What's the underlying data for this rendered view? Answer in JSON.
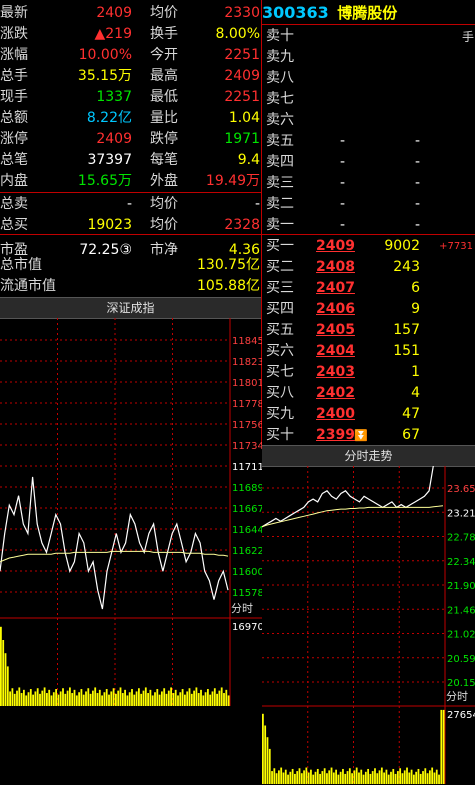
{
  "quote": {
    "rows": [
      {
        "l1": "最新",
        "v1": "2409",
        "c1": "red",
        "l2": "均价",
        "v2": "2330",
        "c2": "red"
      },
      {
        "l1": "涨跌",
        "v1": "▲219",
        "c1": "red",
        "l2": "换手",
        "v2": "8.00%",
        "c2": "yel"
      },
      {
        "l1": "涨幅",
        "v1": "10.00%",
        "c1": "red",
        "l2": "今开",
        "v2": "2251",
        "c2": "red"
      },
      {
        "l1": "总手",
        "v1": "35.15万",
        "c1": "yel",
        "l2": "最高",
        "v2": "2409",
        "c2": "red"
      },
      {
        "l1": "现手",
        "v1": "1337",
        "c1": "grn",
        "l2": "最低",
        "v2": "2251",
        "c2": "red"
      },
      {
        "l1": "总额",
        "v1": "8.22亿",
        "c1": "cyn",
        "l2": "量比",
        "v2": "1.04",
        "c2": "yel"
      },
      {
        "l1": "涨停",
        "v1": "2409",
        "c1": "red",
        "l2": "跌停",
        "v2": "1971",
        "c2": "grn"
      },
      {
        "l1": "总笔",
        "v1": "37397",
        "c1": "wht",
        "l2": "每笔",
        "v2": "9.4",
        "c2": "yel"
      },
      {
        "l1": "内盘",
        "v1": "15.65万",
        "c1": "grn",
        "l2": "外盘",
        "v2": "19.49万",
        "c2": "red"
      },
      {
        "l1": "总卖",
        "v1": "-",
        "c1": "wht",
        "l2": "均价",
        "v2": "-",
        "c2": "wht"
      },
      {
        "l1": "总买",
        "v1": "19023",
        "c1": "yel",
        "l2": "均价",
        "v2": "2328",
        "c2": "red"
      },
      {
        "l1": "市盈",
        "v1": "72.25③",
        "c1": "wht",
        "l2": "市净",
        "v2": "4.36",
        "c2": "yel"
      }
    ],
    "market_cap_label": "总市值",
    "market_cap": "130.75亿",
    "float_cap_label": "流通市值",
    "float_cap": "105.88亿"
  },
  "stock": {
    "code": "300363",
    "name": "博腾股份",
    "unit": "手"
  },
  "order_book": {
    "asks": [
      {
        "label": "卖十",
        "price": "",
        "vol": ""
      },
      {
        "label": "卖九",
        "price": "",
        "vol": ""
      },
      {
        "label": "卖八",
        "price": "",
        "vol": ""
      },
      {
        "label": "卖七",
        "price": "",
        "vol": ""
      },
      {
        "label": "卖六",
        "price": "",
        "vol": ""
      },
      {
        "label": "卖五",
        "price": "-",
        "vol": "-"
      },
      {
        "label": "卖四",
        "price": "-",
        "vol": "-"
      },
      {
        "label": "卖三",
        "price": "-",
        "vol": "-"
      },
      {
        "label": "卖二",
        "price": "-",
        "vol": "-"
      },
      {
        "label": "卖一",
        "price": "-",
        "vol": "-"
      }
    ],
    "bids": [
      {
        "label": "买一",
        "price": "2409",
        "vol": "9002",
        "chg": "+7731"
      },
      {
        "label": "买二",
        "price": "2408",
        "vol": "243",
        "chg": ""
      },
      {
        "label": "买三",
        "price": "2407",
        "vol": "6",
        "chg": ""
      },
      {
        "label": "买四",
        "price": "2406",
        "vol": "9",
        "chg": ""
      },
      {
        "label": "买五",
        "price": "2405",
        "vol": "157",
        "chg": ""
      },
      {
        "label": "买六",
        "price": "2404",
        "vol": "151",
        "chg": ""
      },
      {
        "label": "买七",
        "price": "2403",
        "vol": "1",
        "chg": ""
      },
      {
        "label": "买八",
        "price": "2402",
        "vol": "4",
        "chg": ""
      },
      {
        "label": "买九",
        "price": "2400",
        "vol": "47",
        "chg": ""
      },
      {
        "label": "买十",
        "price": "2399",
        "vol": "67",
        "chg": ""
      }
    ]
  },
  "index_panel": {
    "title": "深证成指",
    "ticks": [
      "11845",
      "11823",
      "11801",
      "11778",
      "11756",
      "11734",
      "11711",
      "11689",
      "11667",
      "11644",
      "11622",
      "11600",
      "11578"
    ],
    "vol_max": "16970",
    "time_label": "分时"
  },
  "intraday_panel": {
    "title": "分时走势",
    "ticks": [
      "23.65",
      "23.21",
      "22.78",
      "22.34",
      "21.90",
      "21.46",
      "21.02",
      "20.59",
      "20.15"
    ],
    "vol_max": "27654",
    "time_label": "分时"
  },
  "colors": {
    "up": "#ff3030",
    "down": "#00e400",
    "grid": "#c00000",
    "price_line": "#ffffff",
    "avg_line": "#ffff99",
    "volume": "#ffff00"
  },
  "chart_data": [
    {
      "type": "line",
      "title": "深证成指",
      "ylim": [
        11578,
        11845
      ],
      "series": [
        {
          "values": [
            11600,
            11640,
            11670,
            11660,
            11680,
            11650,
            11640,
            11700,
            11650,
            11630,
            11620,
            11640,
            11660,
            11650,
            11620,
            11600,
            11610,
            11640,
            11630,
            11600,
            11610,
            11580,
            11560,
            11600,
            11620,
            11640,
            11620,
            11630,
            11660,
            11650,
            11630,
            11620,
            11640,
            11650,
            11620,
            11600,
            11620,
            11640,
            11650,
            11630,
            11610,
            11620,
            11640,
            11630,
            11600,
            11590,
            11570,
            11590,
            11600,
            11580
          ]
        },
        {
          "values": [
            11610,
            11612,
            11614,
            11615,
            11616,
            11617,
            11618,
            11618,
            11618,
            11618,
            11618,
            11618,
            11619,
            11619,
            11619,
            11619,
            11620,
            11620,
            11620,
            11620,
            11620,
            11620,
            11620,
            11620,
            11621,
            11621,
            11621,
            11621,
            11621,
            11621,
            11621,
            11621,
            11621,
            11620,
            11620,
            11620,
            11620,
            11620,
            11620,
            11620,
            11619,
            11619,
            11619,
            11619,
            11618,
            11618,
            11618,
            11617,
            11617,
            11616
          ]
        }
      ]
    },
    {
      "type": "line",
      "title": "分时走势",
      "ylim": [
        20.15,
        23.65
      ],
      "series": [
        {
          "values": [
            22.95,
            23.0,
            23.05,
            23.1,
            23.05,
            23.1,
            23.15,
            23.2,
            23.25,
            23.3,
            23.4,
            23.45,
            23.4,
            23.55,
            23.6,
            23.5,
            23.45,
            23.55,
            23.6,
            23.5,
            23.45,
            23.4,
            23.5,
            23.45,
            23.4,
            23.35,
            23.3,
            23.35,
            23.4,
            23.3,
            23.35,
            23.3,
            23.35,
            23.4,
            23.45,
            23.5,
            23.6,
            24.09,
            24.09,
            24.09
          ]
        },
        {
          "values": [
            22.95,
            22.98,
            23.0,
            23.02,
            23.04,
            23.06,
            23.08,
            23.1,
            23.12,
            23.14,
            23.16,
            23.18,
            23.2,
            23.22,
            23.24,
            23.25,
            23.26,
            23.27,
            23.27,
            23.28,
            23.28,
            23.29,
            23.29,
            23.3,
            23.3,
            23.3,
            23.3,
            23.3,
            23.3,
            23.3,
            23.3,
            23.3,
            23.3,
            23.3,
            23.3,
            23.3,
            23.3,
            23.31,
            23.32,
            23.33
          ]
        }
      ]
    }
  ]
}
